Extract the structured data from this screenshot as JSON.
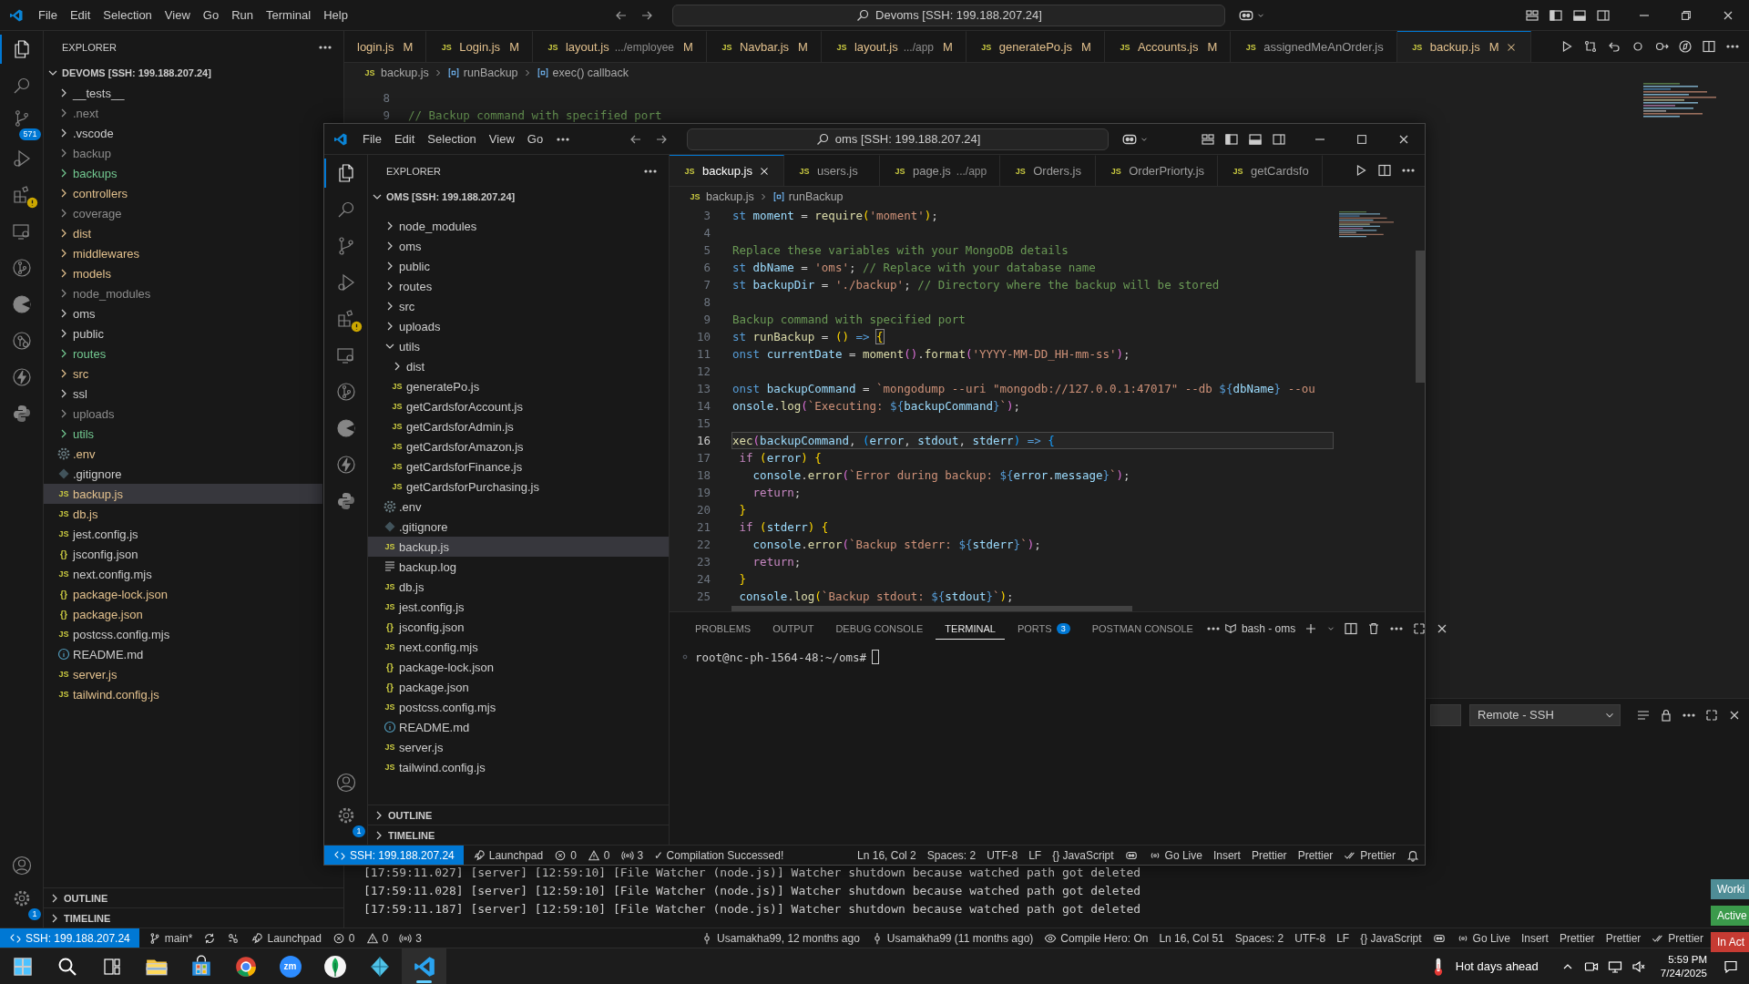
{
  "outer": {
    "title_bar": {
      "menu": [
        "File",
        "Edit",
        "Selection",
        "View",
        "Go",
        "Run",
        "Terminal",
        "Help"
      ],
      "search": "Devoms [SSH: 199.188.207.24]"
    },
    "activity": [
      {
        "kind": "files",
        "selected": true
      },
      {
        "kind": "search",
        "selected": false
      },
      {
        "kind": "source-control",
        "selected": false,
        "badge": "571"
      },
      {
        "kind": "run",
        "selected": false
      },
      {
        "kind": "extensions",
        "selected": false,
        "warning": true
      },
      {
        "kind": "remote",
        "selected": false
      },
      {
        "kind": "branch-circle",
        "selected": false
      },
      {
        "kind": "disc",
        "selected": false
      },
      {
        "kind": "node-graph",
        "selected": false
      },
      {
        "kind": "lightning",
        "selected": false
      },
      {
        "kind": "snake",
        "selected": false
      }
    ],
    "activity_bottom": [
      {
        "kind": "account"
      },
      {
        "kind": "settings",
        "badge": "1"
      }
    ],
    "explorer": {
      "title": "EXPLORER",
      "root": "DEVOMS [SSH: 199.188.207.24]",
      "items": [
        {
          "label": "__tests__",
          "kind": "folder",
          "expanded": false,
          "selected": false,
          "color": "#cccccc"
        },
        {
          "label": ".next",
          "kind": "folder",
          "expanded": false,
          "selected": false,
          "color": "#8c8c8c"
        },
        {
          "label": ".vscode",
          "kind": "folder",
          "expanded": false,
          "selected": false,
          "color": "#cccccc"
        },
        {
          "label": "backup",
          "kind": "folder",
          "expanded": false,
          "selected": false,
          "color": "#8c8c8c"
        },
        {
          "label": "backups",
          "kind": "folder",
          "expanded": false,
          "selected": false,
          "color": "#73c991"
        },
        {
          "label": "controllers",
          "kind": "folder",
          "expanded": false,
          "selected": false,
          "color": "#e2c08d"
        },
        {
          "label": "coverage",
          "kind": "folder",
          "expanded": false,
          "selected": false,
          "color": "#8c8c8c"
        },
        {
          "label": "dist",
          "kind": "folder",
          "expanded": false,
          "selected": false,
          "color": "#e2c08d"
        },
        {
          "label": "middlewares",
          "kind": "folder",
          "expanded": false,
          "selected": false,
          "color": "#e2c08d"
        },
        {
          "label": "models",
          "kind": "folder",
          "expanded": false,
          "selected": false,
          "color": "#e2c08d"
        },
        {
          "label": "node_modules",
          "kind": "folder",
          "expanded": false,
          "selected": false,
          "color": "#8c8c8c"
        },
        {
          "label": "oms",
          "kind": "folder",
          "expanded": false,
          "selected": false,
          "color": "#cccccc"
        },
        {
          "label": "public",
          "kind": "folder",
          "expanded": false,
          "selected": false,
          "color": "#cccccc"
        },
        {
          "label": "routes",
          "kind": "folder",
          "expanded": false,
          "selected": false,
          "color": "#73c991"
        },
        {
          "label": "src",
          "kind": "folder",
          "expanded": false,
          "selected": false,
          "color": "#e2c08d"
        },
        {
          "label": "ssl",
          "kind": "folder",
          "expanded": false,
          "selected": false,
          "color": "#cccccc"
        },
        {
          "label": "uploads",
          "kind": "folder",
          "expanded": false,
          "selected": false,
          "color": "#8c8c8c"
        },
        {
          "label": "utils",
          "kind": "folder",
          "expanded": false,
          "selected": false,
          "color": "#73c991"
        },
        {
          "label": ".env",
          "kind": "env",
          "selected": false,
          "color": "#e2c08d"
        },
        {
          "label": ".gitignore",
          "kind": "git",
          "selected": false,
          "color": "#cccccc"
        },
        {
          "label": "backup.js",
          "kind": "js",
          "icon_label": "JS",
          "selected": true,
          "color": "#e2c08d"
        },
        {
          "label": "db.js",
          "kind": "js",
          "icon_label": "JS",
          "selected": false,
          "color": "#e2c08d"
        },
        {
          "label": "jest.config.js",
          "kind": "js",
          "icon_label": "JS",
          "selected": false,
          "color": "#cccccc"
        },
        {
          "label": "jsconfig.json",
          "kind": "json",
          "icon_label": "{}",
          "selected": false,
          "color": "#cccccc"
        },
        {
          "label": "next.config.mjs",
          "kind": "js",
          "icon_label": "JS",
          "selected": false,
          "color": "#cccccc"
        },
        {
          "label": "package-lock.json",
          "kind": "json",
          "icon_label": "{}",
          "selected": false,
          "color": "#e2c08d"
        },
        {
          "label": "package.json",
          "kind": "json",
          "icon_label": "{}",
          "selected": false,
          "color": "#e2c08d"
        },
        {
          "label": "postcss.config.mjs",
          "kind": "js",
          "icon_label": "JS",
          "selected": false,
          "color": "#cccccc"
        },
        {
          "label": "README.md",
          "kind": "info",
          "selected": false,
          "color": "#cccccc"
        },
        {
          "label": "server.js",
          "kind": "js",
          "icon_label": "JS",
          "selected": false,
          "color": "#e2c08d"
        },
        {
          "label": "tailwind.config.js",
          "kind": "js",
          "icon_label": "JS",
          "selected": false,
          "color": "#e2c08d"
        }
      ]
    },
    "sections": [
      "OUTLINE",
      "TIMELINE"
    ],
    "tabs": [
      {
        "label": "login.js",
        "status": "M",
        "selected": false
      },
      {
        "label": "Login.js",
        "icon_label": "JS",
        "status": "M",
        "selected": false
      },
      {
        "label": "layout.js",
        "detail": ".../employee",
        "icon_label": "JS",
        "status": "M",
        "selected": false
      },
      {
        "label": "Navbar.js",
        "icon_label": "JS",
        "status": "M",
        "selected": false
      },
      {
        "label": "layout.js",
        "detail": ".../app",
        "icon_label": "JS",
        "status": "M",
        "selected": false
      },
      {
        "label": "generatePo.js",
        "icon_label": "JS",
        "status": "M",
        "selected": false
      },
      {
        "label": "Accounts.js",
        "icon_label": "JS",
        "status": "M",
        "selected": false
      },
      {
        "label": "assignedMeAnOrder.js",
        "icon_label": "JS",
        "selected": false
      },
      {
        "label": "backup.js",
        "icon_label": "JS",
        "status": "M",
        "selected": true
      }
    ],
    "breadcrumb": [
      {
        "label": "backup.js",
        "kind": "file",
        "icon_label": "JS"
      },
      {
        "label": "runBackup",
        "kind": "symbol"
      },
      {
        "label": "exec() callback",
        "kind": "symbol"
      }
    ],
    "code": [
      {
        "n": "8"
      },
      {
        "n": "9",
        "tokens": [
          {
            "kind": "cm",
            "text": "// Backup command with specified port"
          }
        ]
      }
    ],
    "panel": {
      "dropdown": "Remote - SSH",
      "output": [
        "[17:59:11.027] [server] [12:59:10] [File Watcher (node.js)] Watcher shutdown because watched path got deleted",
        "[17:59:11.028] [server] [12:59:10] [File Watcher (node.js)] Watcher shutdown because watched path got deleted",
        "[17:59:11.187] [server] [12:59:10] [File Watcher (node.js)] Watcher shutdown because watched path got deleted"
      ]
    },
    "status_left": [
      {
        "kind": "remote",
        "text": "SSH: 199.188.207.24"
      },
      {
        "kind": "branch",
        "text": "main*"
      },
      {
        "kind": "sync"
      },
      {
        "kind": "tool"
      },
      {
        "kind": "rocket",
        "text": "Launchpad"
      },
      {
        "kind": "error",
        "text": "0"
      },
      {
        "kind": "warning",
        "text": "0"
      },
      {
        "kind": "ports",
        "text": "3"
      }
    ],
    "status_right": [
      {
        "kind": "commit",
        "text": "Usamakha99, 12 months ago"
      },
      {
        "kind": "commit",
        "text": "Usamakha99 (11 months ago)"
      },
      {
        "kind": "eye",
        "text": "Compile Hero: On"
      },
      {
        "text": "Ln 16, Col 51"
      },
      {
        "text": "Spaces: 2"
      },
      {
        "text": "UTF-8"
      },
      {
        "text": "LF"
      },
      {
        "text": "{} JavaScript"
      },
      {
        "kind": "assistant"
      },
      {
        "kind": "radio",
        "text": "Go Live"
      },
      {
        "text": "Insert"
      },
      {
        "text": "Prettier"
      },
      {
        "text": "Prettier"
      },
      {
        "kind": "double-check",
        "text": "Prettier"
      }
    ]
  },
  "inner": {
    "title_bar": {
      "menu": [
        "File",
        "Edit",
        "Selection",
        "View",
        "Go"
      ],
      "search": "oms [SSH: 199.188.207.24]"
    },
    "activity": [
      {
        "kind": "files",
        "selected": true
      },
      {
        "kind": "search",
        "selected": false
      },
      {
        "kind": "source-control",
        "selected": false
      },
      {
        "kind": "run",
        "selected": false
      },
      {
        "kind": "extensions",
        "selected": false,
        "warning": true
      },
      {
        "kind": "remote",
        "selected": false
      },
      {
        "kind": "branch-circle",
        "selected": false
      },
      {
        "kind": "disc",
        "selected": false
      },
      {
        "kind": "lightning",
        "selected": false
      },
      {
        "kind": "snake",
        "selected": false
      }
    ],
    "activity_bottom": [
      {
        "kind": "account"
      },
      {
        "kind": "settings",
        "badge": "1"
      }
    ],
    "explorer": {
      "title": "EXPLORER",
      "root": "OMS [SSH: 199.188.207.24]",
      "items": [
        {
          "label": "node_modules",
          "kind": "folder",
          "expanded": false,
          "selected": false
        },
        {
          "label": "oms",
          "kind": "folder",
          "expanded": false,
          "selected": false
        },
        {
          "label": "public",
          "kind": "folder",
          "expanded": false,
          "selected": false
        },
        {
          "label": "routes",
          "kind": "folder",
          "expanded": false,
          "selected": false
        },
        {
          "label": "src",
          "kind": "folder",
          "expanded": false,
          "selected": false
        },
        {
          "label": "uploads",
          "kind": "folder",
          "expanded": false,
          "selected": false
        },
        {
          "label": "utils",
          "kind": "folder",
          "expanded": true,
          "selected": false,
          "children": [
            {
              "label": "dist",
              "kind": "folder",
              "expanded": false,
              "selected": false
            },
            {
              "label": "generatePo.js",
              "kind": "js",
              "icon_label": "JS",
              "selected": false
            },
            {
              "label": "getCardsforAccount.js",
              "kind": "js",
              "icon_label": "JS",
              "selected": false
            },
            {
              "label": "getCardsforAdmin.js",
              "kind": "js",
              "icon_label": "JS",
              "selected": false
            },
            {
              "label": "getCardsforAmazon.js",
              "kind": "js",
              "icon_label": "JS",
              "selected": false
            },
            {
              "label": "getCardsforFinance.js",
              "kind": "js",
              "icon_label": "JS",
              "selected": false
            },
            {
              "label": "getCardsforPurchasing.js",
              "kind": "js",
              "icon_label": "JS",
              "selected": false
            }
          ]
        },
        {
          "label": ".env",
          "kind": "env",
          "selected": false
        },
        {
          "label": ".gitignore",
          "kind": "git",
          "selected": false
        },
        {
          "label": "backup.js",
          "kind": "js",
          "icon_label": "JS",
          "selected": true
        },
        {
          "label": "backup.log",
          "kind": "log",
          "selected": false
        },
        {
          "label": "db.js",
          "kind": "js",
          "icon_label": "JS",
          "selected": false
        },
        {
          "label": "jest.config.js",
          "kind": "js",
          "icon_label": "JS",
          "selected": false
        },
        {
          "label": "jsconfig.json",
          "kind": "json",
          "icon_label": "{}",
          "selected": false
        },
        {
          "label": "next.config.mjs",
          "kind": "js",
          "icon_label": "JS",
          "selected": false
        },
        {
          "label": "package-lock.json",
          "kind": "json",
          "icon_label": "{}",
          "selected": false
        },
        {
          "label": "package.json",
          "kind": "json",
          "icon_label": "{}",
          "selected": false
        },
        {
          "label": "postcss.config.mjs",
          "kind": "js",
          "icon_label": "JS",
          "selected": false
        },
        {
          "label": "README.md",
          "kind": "info",
          "selected": false
        },
        {
          "label": "server.js",
          "kind": "js",
          "icon_label": "JS",
          "selected": false
        },
        {
          "label": "tailwind.config.js",
          "kind": "js",
          "icon_label": "JS",
          "selected": false
        }
      ]
    },
    "sections": [
      "OUTLINE",
      "TIMELINE"
    ],
    "tabs": [
      {
        "label": "backup.js",
        "icon_label": "JS",
        "selected": true
      },
      {
        "label": "users.js",
        "icon_label": "JS",
        "selected": false
      },
      {
        "label": "page.js",
        "detail": ".../app",
        "icon_label": "JS",
        "selected": false
      },
      {
        "label": "Orders.js",
        "icon_label": "JS",
        "selected": false
      },
      {
        "label": "OrderPriorty.js",
        "icon_label": "JS",
        "selected": false
      },
      {
        "label": "getCardsfo",
        "icon_label": "JS",
        "selected": false
      }
    ],
    "breadcrumb": [
      {
        "label": "backup.js",
        "kind": "file",
        "icon_label": "JS"
      },
      {
        "label": "runBackup",
        "kind": "symbol"
      }
    ],
    "code": [
      {
        "n": "3",
        "current": false,
        "tokens": [
          {
            "kind": "kw",
            "text": "st "
          },
          {
            "kind": "var",
            "text": "moment"
          },
          {
            "kind": "pl",
            "text": " = "
          },
          {
            "kind": "fn",
            "text": "require"
          },
          {
            "kind": "b1",
            "text": "("
          },
          {
            "kind": "str",
            "text": "'moment'"
          },
          {
            "kind": "b1",
            "text": ")"
          },
          {
            "kind": "pl",
            "text": ";"
          }
        ]
      },
      {
        "n": "4",
        "current": false
      },
      {
        "n": "5",
        "current": false,
        "tokens": [
          {
            "kind": "cm",
            "text": "Replace these variables with your MongoDB details"
          }
        ]
      },
      {
        "n": "6",
        "current": false,
        "tokens": [
          {
            "kind": "kw",
            "text": "st "
          },
          {
            "kind": "var",
            "text": "dbName"
          },
          {
            "kind": "pl",
            "text": " = "
          },
          {
            "kind": "str",
            "text": "'oms'"
          },
          {
            "kind": "pl",
            "text": "; "
          },
          {
            "kind": "cm",
            "text": "// Replace with your database name"
          }
        ]
      },
      {
        "n": "7",
        "current": false,
        "tokens": [
          {
            "kind": "kw",
            "text": "st "
          },
          {
            "kind": "var",
            "text": "backupDir"
          },
          {
            "kind": "pl",
            "text": " = "
          },
          {
            "kind": "str",
            "text": "'./backup'"
          },
          {
            "kind": "pl",
            "text": "; "
          },
          {
            "kind": "cm",
            "text": "// Directory where the backup will be stored"
          }
        ]
      },
      {
        "n": "8",
        "current": false
      },
      {
        "n": "9",
        "current": false,
        "tokens": [
          {
            "kind": "cm",
            "text": "Backup command with specified port"
          }
        ]
      },
      {
        "n": "10",
        "current": false,
        "tokens": [
          {
            "kind": "kw",
            "text": "st "
          },
          {
            "kind": "fn",
            "text": "runBackup"
          },
          {
            "kind": "pl",
            "text": " = "
          },
          {
            "kind": "b1",
            "text": "() "
          },
          {
            "kind": "kw",
            "text": "=> "
          },
          {
            "kind": "match",
            "text": "{"
          }
        ]
      },
      {
        "n": "11",
        "current": false,
        "tokens": [
          {
            "kind": "kw",
            "text": "onst "
          },
          {
            "kind": "var",
            "text": "currentDate"
          },
          {
            "kind": "pl",
            "text": " = "
          },
          {
            "kind": "fn",
            "text": "moment"
          },
          {
            "kind": "b2",
            "text": "()"
          },
          {
            "kind": "pl",
            "text": "."
          },
          {
            "kind": "fn",
            "text": "format"
          },
          {
            "kind": "b2",
            "text": "("
          },
          {
            "kind": "str",
            "text": "'YYYY-MM-DD_HH-mm-ss'"
          },
          {
            "kind": "b2",
            "text": ")"
          },
          {
            "kind": "pl",
            "text": ";"
          }
        ]
      },
      {
        "n": "12",
        "current": false
      },
      {
        "n": "13",
        "current": false,
        "tokens": [
          {
            "kind": "kw",
            "text": "onst "
          },
          {
            "kind": "var",
            "text": "backupCommand"
          },
          {
            "kind": "pl",
            "text": " = "
          },
          {
            "kind": "str",
            "text": "`mongodump --uri \"mongodb://127.0.0.1:47017\" --db "
          },
          {
            "kind": "kw",
            "text": "${"
          },
          {
            "kind": "var",
            "text": "dbName"
          },
          {
            "kind": "kw",
            "text": "}"
          },
          {
            "kind": "str",
            "text": " --ou"
          }
        ]
      },
      {
        "n": "14",
        "current": false,
        "tokens": [
          {
            "kind": "var",
            "text": "onsole"
          },
          {
            "kind": "pl",
            "text": "."
          },
          {
            "kind": "fn",
            "text": "log"
          },
          {
            "kind": "b2",
            "text": "("
          },
          {
            "kind": "str",
            "text": "`Executing: "
          },
          {
            "kind": "kw",
            "text": "${"
          },
          {
            "kind": "var",
            "text": "backupCommand"
          },
          {
            "kind": "kw",
            "text": "}"
          },
          {
            "kind": "str",
            "text": "`"
          },
          {
            "kind": "b2",
            "text": ")"
          },
          {
            "kind": "pl",
            "text": ";"
          }
        ]
      },
      {
        "n": "15",
        "current": false
      },
      {
        "n": "16",
        "current": true,
        "tokens": [
          {
            "kind": "fn",
            "text": "xec"
          },
          {
            "kind": "b2",
            "text": "("
          },
          {
            "kind": "var",
            "text": "backupCommand"
          },
          {
            "kind": "pl",
            "text": ", "
          },
          {
            "kind": "b3",
            "text": "("
          },
          {
            "kind": "var",
            "text": "error"
          },
          {
            "kind": "pl",
            "text": ", "
          },
          {
            "kind": "var",
            "text": "stdout"
          },
          {
            "kind": "pl",
            "text": ", "
          },
          {
            "kind": "var",
            "text": "stderr"
          },
          {
            "kind": "b3",
            "text": ") "
          },
          {
            "kind": "kw",
            "text": "=> "
          },
          {
            "kind": "b3",
            "text": "{"
          }
        ]
      },
      {
        "n": "17",
        "current": false,
        "tokens": [
          {
            "kind": "ctl",
            "text": " if "
          },
          {
            "kind": "b1",
            "text": "("
          },
          {
            "kind": "var",
            "text": "error"
          },
          {
            "kind": "b1",
            "text": ") {"
          }
        ]
      },
      {
        "n": "18",
        "current": false,
        "tokens": [
          {
            "kind": "var",
            "text": "   console"
          },
          {
            "kind": "pl",
            "text": "."
          },
          {
            "kind": "fn",
            "text": "error"
          },
          {
            "kind": "b2",
            "text": "("
          },
          {
            "kind": "str",
            "text": "`Error during backup: "
          },
          {
            "kind": "kw",
            "text": "${"
          },
          {
            "kind": "var",
            "text": "error"
          },
          {
            "kind": "pl",
            "text": "."
          },
          {
            "kind": "var",
            "text": "message"
          },
          {
            "kind": "kw",
            "text": "}"
          },
          {
            "kind": "str",
            "text": "`"
          },
          {
            "kind": "b2",
            "text": ")"
          },
          {
            "kind": "pl",
            "text": ";"
          }
        ]
      },
      {
        "n": "19",
        "current": false,
        "tokens": [
          {
            "kind": "ctl",
            "text": "   return"
          },
          {
            "kind": "pl",
            "text": ";"
          }
        ]
      },
      {
        "n": "20",
        "current": false,
        "tokens": [
          {
            "kind": "b1",
            "text": " }"
          }
        ]
      },
      {
        "n": "21",
        "current": false,
        "tokens": [
          {
            "kind": "ctl",
            "text": " if "
          },
          {
            "kind": "b1",
            "text": "("
          },
          {
            "kind": "var",
            "text": "stderr"
          },
          {
            "kind": "b1",
            "text": ") {"
          }
        ]
      },
      {
        "n": "22",
        "current": false,
        "tokens": [
          {
            "kind": "var",
            "text": "   console"
          },
          {
            "kind": "pl",
            "text": "."
          },
          {
            "kind": "fn",
            "text": "error"
          },
          {
            "kind": "b2",
            "text": "("
          },
          {
            "kind": "str",
            "text": "`Backup stderr: "
          },
          {
            "kind": "kw",
            "text": "${"
          },
          {
            "kind": "var",
            "text": "stderr"
          },
          {
            "kind": "kw",
            "text": "}"
          },
          {
            "kind": "str",
            "text": "`"
          },
          {
            "kind": "b2",
            "text": ")"
          },
          {
            "kind": "pl",
            "text": ";"
          }
        ]
      },
      {
        "n": "23",
        "current": false,
        "tokens": [
          {
            "kind": "ctl",
            "text": "   return"
          },
          {
            "kind": "pl",
            "text": ";"
          }
        ]
      },
      {
        "n": "24",
        "current": false,
        "tokens": [
          {
            "kind": "b1",
            "text": " }"
          }
        ]
      },
      {
        "n": "25",
        "current": false,
        "tokens": [
          {
            "kind": "var",
            "text": " console"
          },
          {
            "kind": "pl",
            "text": "."
          },
          {
            "kind": "fn",
            "text": "log"
          },
          {
            "kind": "b1",
            "text": "("
          },
          {
            "kind": "str",
            "text": "`Backup stdout: "
          },
          {
            "kind": "kw",
            "text": "${"
          },
          {
            "kind": "var",
            "text": "stdout"
          },
          {
            "kind": "kw",
            "text": "}"
          },
          {
            "kind": "str",
            "text": "`"
          },
          {
            "kind": "b1",
            "text": ")"
          },
          {
            "kind": "pl",
            "text": ";"
          }
        ]
      }
    ],
    "panel": {
      "tabs": [
        {
          "label": "PROBLEMS",
          "selected": false
        },
        {
          "label": "OUTPUT",
          "selected": false
        },
        {
          "label": "DEBUG CONSOLE",
          "selected": false
        },
        {
          "label": "TERMINAL",
          "selected": true
        },
        {
          "label": "PORTS",
          "count": "3",
          "selected": false
        },
        {
          "label": "POSTMAN CONSOLE",
          "selected": false
        }
      ],
      "terminal_name": "bash - oms",
      "prompt": "root@nc-ph-1564-48:~/oms#"
    },
    "status_left": [
      {
        "kind": "remote",
        "text": "SSH: 199.188.207.24"
      },
      {
        "kind": "rocket",
        "text": "Launchpad"
      },
      {
        "kind": "error",
        "text": "0"
      },
      {
        "kind": "warning",
        "text": "0"
      },
      {
        "kind": "ports",
        "text": "3"
      },
      {
        "text": "✓ Compilation Successed!"
      }
    ],
    "status_right": [
      {
        "text": "Ln 16, Col 2"
      },
      {
        "text": "Spaces: 2"
      },
      {
        "text": "UTF-8"
      },
      {
        "text": "LF"
      },
      {
        "text": "{} JavaScript"
      },
      {
        "kind": "assistant"
      },
      {
        "kind": "radio",
        "text": "Go Live"
      },
      {
        "text": "Insert"
      },
      {
        "text": "Prettier"
      },
      {
        "text": "Prettier"
      },
      {
        "kind": "double-check",
        "text": "Prettier"
      },
      {
        "kind": "bell"
      }
    ]
  },
  "extension_buttons": [
    {
      "label": "Worki",
      "color": "#4f8d96"
    },
    {
      "label": "Active",
      "color": "#3b9a4b"
    },
    {
      "label": "In Act",
      "color": "#c63b33"
    }
  ],
  "taskbar": {
    "apps": [
      {
        "kind": "start",
        "selected": false
      },
      {
        "kind": "search",
        "selected": false
      },
      {
        "kind": "task-view",
        "selected": false
      },
      {
        "kind": "folder",
        "selected": false
      },
      {
        "kind": "store",
        "selected": false
      },
      {
        "kind": "browser",
        "selected": false
      },
      {
        "kind": "video",
        "label": "zm",
        "selected": false
      },
      {
        "kind": "leaf",
        "selected": false
      },
      {
        "kind": "diamond",
        "selected": false
      },
      {
        "kind": "code",
        "selected": true
      }
    ],
    "weather": "Hot days ahead",
    "time": "5:59 PM",
    "date": "7/24/2025"
  }
}
